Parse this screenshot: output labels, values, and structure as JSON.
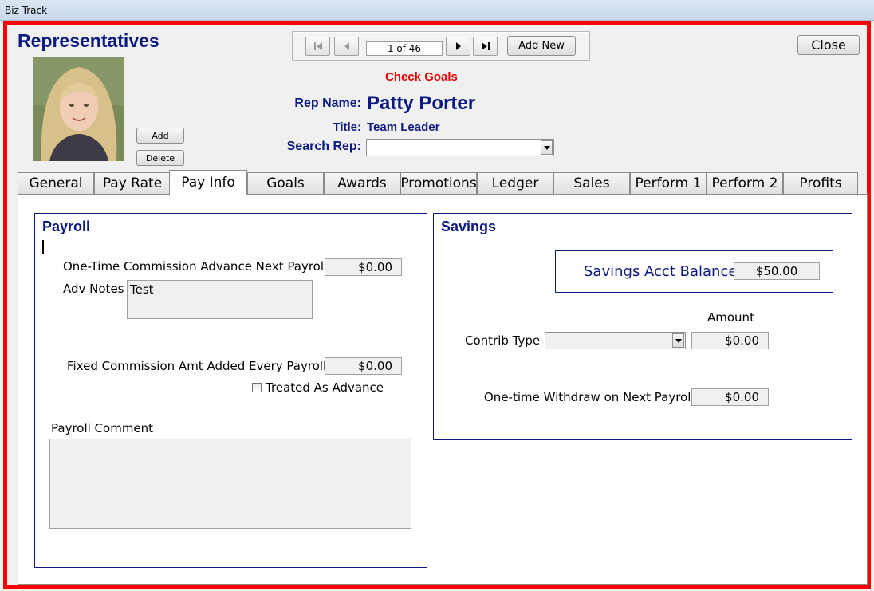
{
  "window": {
    "title": "Biz Track"
  },
  "header": {
    "title": "Representatives",
    "check_goals": "Check Goals"
  },
  "photo": {
    "add_label": "Add",
    "delete_label": "Delete"
  },
  "nav": {
    "record": "1 of 46",
    "add_new_label": "Add New",
    "close_label": "Close"
  },
  "rep": {
    "name_label": "Rep Name:",
    "name": "Patty Porter",
    "title_label": "Title:",
    "title": "Team Leader",
    "search_label": "Search Rep:",
    "search_value": ""
  },
  "tabs": [
    "General",
    "Pay Rate",
    "Pay Info",
    "Goals",
    "Awards",
    "Promotions",
    "Ledger",
    "Sales",
    "Perform 1",
    "Perform 2",
    "Profits"
  ],
  "active_tab": "Pay Info",
  "payroll": {
    "title": "Payroll",
    "advance_label": "One-Time Commission Advance Next Payroll",
    "advance_value": "$0.00",
    "adv_notes_label": "Adv Notes",
    "adv_notes_value": "Test",
    "fixed_label": "Fixed Commission Amt Added Every Payroll",
    "fixed_value": "$0.00",
    "treated_label": "Treated As Advance",
    "treated_checked": false,
    "comment_label": "Payroll Comment",
    "comment_value": ""
  },
  "savings": {
    "title": "Savings",
    "balance_label": "Savings Acct Balance",
    "balance_value": "$50.00",
    "amount_label": "Amount",
    "contrib_label": "Contrib Type",
    "contrib_value": "",
    "contrib_amount": "$0.00",
    "withdraw_label": "One-time Withdraw on Next Payroll",
    "withdraw_value": "$0.00"
  },
  "colors": {
    "accent_navy": "#0b1a82",
    "alert_red": "#e60000",
    "frame_red": "#ff0000"
  }
}
